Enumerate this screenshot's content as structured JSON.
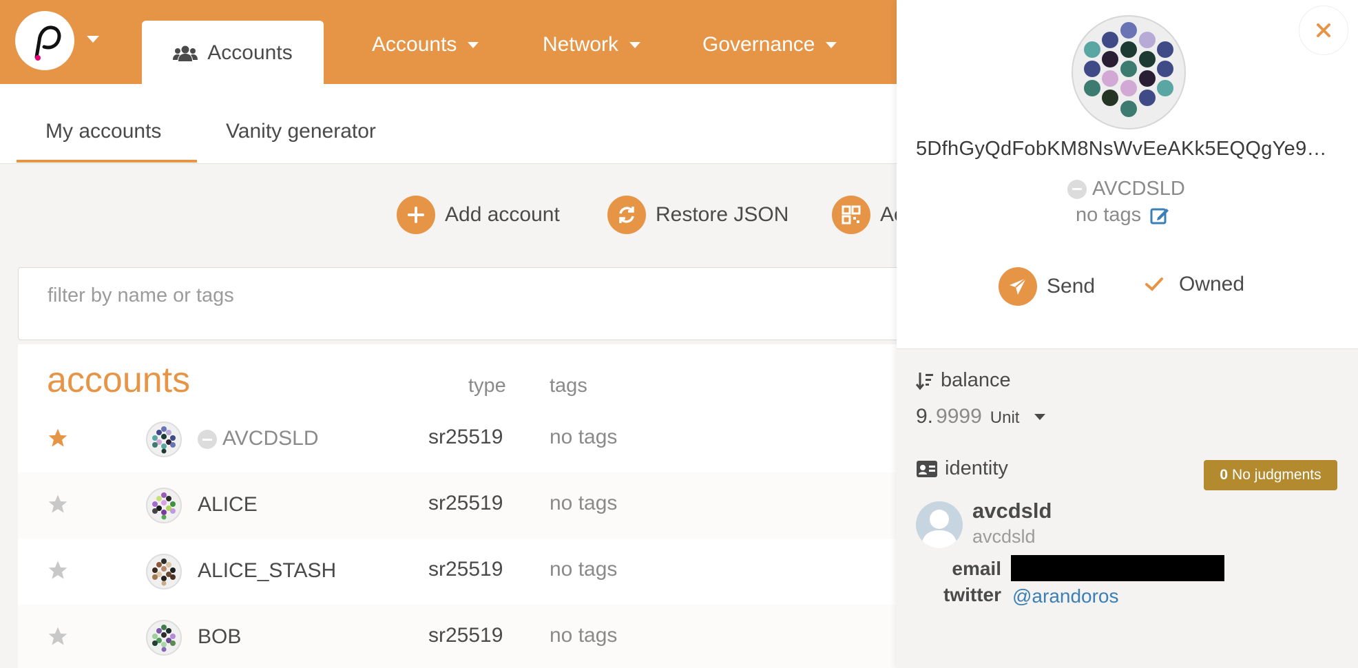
{
  "topbar": {
    "active_tab": "Accounts",
    "menus": [
      {
        "label": "Accounts"
      },
      {
        "label": "Network"
      },
      {
        "label": "Governance"
      }
    ]
  },
  "subnav": {
    "tabs": [
      {
        "label": "My accounts"
      },
      {
        "label": "Vanity generator"
      }
    ]
  },
  "actions": {
    "add_account": "Add account",
    "restore_json": "Restore JSON",
    "third": "Ac"
  },
  "filter": {
    "placeholder": "filter by name or tags",
    "value": ""
  },
  "table": {
    "title": "accounts",
    "col_type": "type",
    "col_tags": "tags",
    "rows": [
      {
        "name": "AVCDSLD",
        "type": "sr25519",
        "tags": "no tags",
        "favorite": true
      },
      {
        "name": "ALICE",
        "type": "sr25519",
        "tags": "no tags",
        "favorite": false
      },
      {
        "name": "ALICE_STASH",
        "type": "sr25519",
        "tags": "no tags",
        "favorite": false
      },
      {
        "name": "BOB",
        "type": "sr25519",
        "tags": "no tags",
        "favorite": false
      }
    ]
  },
  "panel": {
    "address": "5DfhGyQdFobKM8NsWvEeAKk5EQQgYe9A…",
    "name": "AVCDSLD",
    "tags": "no tags",
    "send": "Send",
    "owned": "Owned",
    "balance_label": "balance",
    "balance_int": "9.",
    "balance_frac": "9999",
    "balance_unit": "Unit",
    "identity_label": "identity",
    "judgments_count": "0",
    "judgments_label": "No judgments",
    "identity_name": "avcdsld",
    "identity_sub": "avcdsld",
    "email_key": "email",
    "twitter_key": "twitter",
    "twitter_value": "@arandoros"
  },
  "colors": {
    "accent": "#e69547",
    "judgment_badge": "#b48a2e",
    "link": "#3a7fb5"
  }
}
